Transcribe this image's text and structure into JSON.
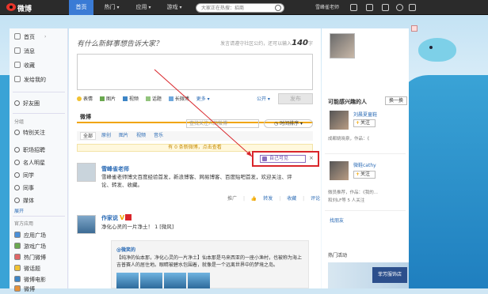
{
  "brand": {
    "logo_text": "微博"
  },
  "topnav": {
    "items": [
      "首页",
      "热门",
      "应用",
      "游戏"
    ],
    "search_placeholder": "大家正在热搜：招商",
    "username": "雪峰雀老师"
  },
  "sidebar": {
    "items": [
      {
        "label": "首页",
        "icon": "home-icon"
      },
      {
        "label": "消息",
        "icon": "message-icon"
      },
      {
        "label": "收藏",
        "icon": "star-icon"
      },
      {
        "label": "发给我的",
        "icon": "send-icon"
      }
    ],
    "friends_circle": "好友圈",
    "group_header": "分组",
    "groups": [
      "特别关注",
      "职场招聘",
      "名人明星",
      "同学",
      "同事",
      "媒体"
    ],
    "expand": "展开",
    "apps_header": "官方应用",
    "apps": [
      "应用广场",
      "游戏广场",
      "热门微博",
      "微话题",
      "微博电影",
      "微博"
    ]
  },
  "composer": {
    "prompt": "有什么新鲜事想告诉大家？",
    "hint_prefix": "发言请遵守社区公约，还可以输入",
    "hint_count": "140",
    "hint_suffix": "字",
    "tools": [
      "表情",
      "图片",
      "视频",
      "话题",
      "长微博",
      "更多"
    ],
    "visibility": "公开",
    "send": "发布"
  },
  "feed": {
    "tab": "微博",
    "search_placeholder": "查找关注人的微博",
    "sort": "时间排序",
    "subtabs": [
      "全部",
      "原创",
      "图片",
      "视频",
      "音乐"
    ],
    "notice": "有 0 条新微博，点击查看",
    "visibility_btn": "自己可见",
    "close": "×",
    "posts": [
      {
        "author": "雪峰雀老师",
        "text": "雪峰雀老师博文百度经验首发，新浪博客、网易博客、百度贴吧首发，欢迎关注、评论、转发、收藏。",
        "actions": [
          "推广",
          "转发",
          "收藏",
          "评论"
        ]
      },
      {
        "author": "作家说",
        "text": "净化心灵的一片净土！ 1 [微风]",
        "quote_author": "@微笑的",
        "quote_text": "【纯净的仙本那，净化心灵的一片净土】仙本那是马来西亚的一座小渔村，也被称为海上吉普赛人的居住地。眼睛被碧水包围着，就像是一个远离世界中的梦境之岛。"
      }
    ]
  },
  "right": {
    "stats": "",
    "recommend_header": "可能感兴趣的人",
    "change": "换一换",
    "people": [
      {
        "name": "刘晨夏童鞋",
        "note": "成都姚晓泉，作品：《"
      },
      {
        "name": "微鞋cathy",
        "note": "微员推荐，作品：《我的..."
      },
      {
        "name": "",
        "note": "和刘LF等 5 人关注"
      }
    ],
    "follow": "关注",
    "more": "找朋友",
    "ad_title": "热门活动",
    "ad_text": "菲芳服饰店"
  }
}
